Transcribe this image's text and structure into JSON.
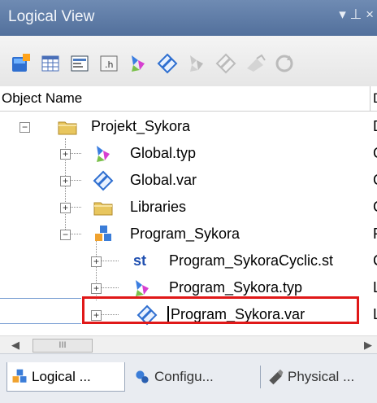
{
  "window": {
    "title": "Logical View",
    "pin_glyph": "▾ ⊥ ×"
  },
  "columns": {
    "name": "Object Name",
    "second": "D"
  },
  "tree": [
    {
      "label": "Projekt_Sykora",
      "icon": "folder-icon",
      "extra": "D"
    },
    {
      "label": "Global.typ",
      "icon": "type-icon",
      "extra": "G"
    },
    {
      "label": "Global.var",
      "icon": "variable-icon",
      "extra": "G"
    },
    {
      "label": "Libraries",
      "icon": "folder-icon",
      "extra": "G"
    },
    {
      "label": "Program_Sykora",
      "icon": "program-icon",
      "extra": "P"
    },
    {
      "label": "Program_SykoraCyclic.st",
      "icon": "st-file-icon",
      "st": "st",
      "extra": "C"
    },
    {
      "label": "Program_Sykora.typ",
      "icon": "type-icon",
      "extra": "L"
    },
    {
      "label": "Program_Sykora.var",
      "icon": "variable-icon",
      "extra": "L"
    }
  ],
  "scroll": {
    "thumb": "III"
  },
  "tabs": [
    {
      "label": "Logical ...",
      "icon": "logical-view-icon"
    },
    {
      "label": "Configu...",
      "icon": "configuration-icon"
    },
    {
      "label": "Physical ...",
      "icon": "physical-view-icon"
    }
  ],
  "colors": {
    "title_bar": "#5b78a3",
    "highlight": "#e01818",
    "selection_line": "#7a9fd3"
  }
}
